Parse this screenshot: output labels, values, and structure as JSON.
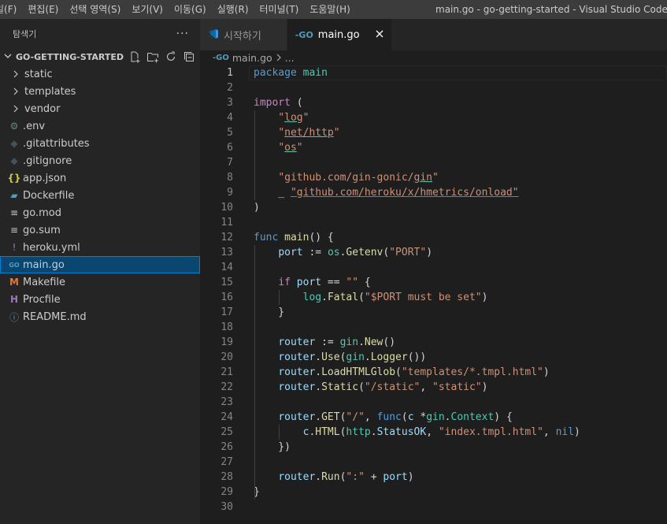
{
  "menu": [
    "일(F)",
    "편집(E)",
    "선택 영역(S)",
    "보기(V)",
    "이동(G)",
    "실행(R)",
    "터미널(T)",
    "도움말(H)"
  ],
  "window_title": "main.go - go-getting-started - Visual Studio Code",
  "sidebar": {
    "header": "탐색기",
    "more": "···",
    "section": "GO-GETTING-STARTED",
    "items": [
      {
        "label": "static",
        "type": "folder",
        "icon": "chevron-right-icon"
      },
      {
        "label": "templates",
        "type": "folder",
        "icon": "chevron-right-icon"
      },
      {
        "label": "vendor",
        "type": "folder",
        "icon": "chevron-right-icon"
      },
      {
        "label": ".env",
        "type": "file",
        "icon": "gear-icon",
        "glyph": "⚙",
        "color": "#6d8086"
      },
      {
        "label": ".gitattributes",
        "type": "file",
        "icon": "git-icon",
        "glyph": "◆",
        "color": "#41535b"
      },
      {
        "label": ".gitignore",
        "type": "file",
        "icon": "git-icon",
        "glyph": "◆",
        "color": "#41535b"
      },
      {
        "label": "app.json",
        "type": "file",
        "icon": "json-icon",
        "glyph": "{}",
        "color": "#cbcb41"
      },
      {
        "label": "Dockerfile",
        "type": "file",
        "icon": "docker-icon",
        "glyph": "▰",
        "color": "#519aba"
      },
      {
        "label": "go.mod",
        "type": "file",
        "icon": "lines-icon",
        "glyph": "≡",
        "color": "#cccccc"
      },
      {
        "label": "go.sum",
        "type": "file",
        "icon": "lines-icon",
        "glyph": "≡",
        "color": "#cccccc"
      },
      {
        "label": "heroku.yml",
        "type": "file",
        "icon": "yaml-icon",
        "glyph": "!",
        "color": "#a074c4"
      },
      {
        "label": "main.go",
        "type": "file",
        "icon": "go-icon",
        "glyph": "GO",
        "color": "#519aba",
        "selected": true
      },
      {
        "label": "Makefile",
        "type": "file",
        "icon": "makefile-icon",
        "glyph": "M",
        "color": "#e37933"
      },
      {
        "label": "Procfile",
        "type": "file",
        "icon": "procfile-icon",
        "glyph": "H",
        "color": "#a074c4"
      },
      {
        "label": "README.md",
        "type": "file",
        "icon": "info-icon",
        "glyph": "ⓘ",
        "color": "#519aba"
      }
    ]
  },
  "tabs": [
    {
      "label": "시작하기",
      "icon": "vscode-icon",
      "active": false
    },
    {
      "label": "main.go",
      "icon": "go-icon",
      "active": true
    }
  ],
  "breadcrumb": {
    "file": "main.go",
    "rest": "..."
  },
  "editor": {
    "current_line": 1,
    "lines": [
      [
        [
          "package",
          "kw"
        ],
        [
          " "
        ],
        [
          "main",
          "pkg"
        ]
      ],
      [],
      [
        [
          "import",
          "ctl"
        ],
        [
          " ("
        ]
      ],
      [
        [
          "    "
        ],
        [
          "\"",
          "str"
        ],
        [
          "log",
          "str ul-g"
        ],
        [
          "\"",
          "str"
        ]
      ],
      [
        [
          "    "
        ],
        [
          "\"",
          "str"
        ],
        [
          "net/http",
          "str ul-g"
        ],
        [
          "\"",
          "str"
        ]
      ],
      [
        [
          "    "
        ],
        [
          "\"",
          "str"
        ],
        [
          "os",
          "str ul-g"
        ],
        [
          "\"",
          "str"
        ]
      ],
      [],
      [
        [
          "    "
        ],
        [
          "\"github.com/gin-gonic/",
          "str"
        ],
        [
          "gin",
          "str ul-g"
        ],
        [
          "\"",
          "str"
        ]
      ],
      [
        [
          "    _ "
        ],
        [
          "\"github.com/heroku/x/hmetrics/onload\"",
          "str ul-r"
        ]
      ],
      [
        [
          ")"
        ]
      ],
      [],
      [
        [
          "func",
          "kw"
        ],
        [
          " "
        ],
        [
          "main",
          "fn"
        ],
        [
          "() {"
        ]
      ],
      [
        [
          "    "
        ],
        [
          "port",
          "var"
        ],
        [
          " := "
        ],
        [
          "os",
          "pkg"
        ],
        [
          "."
        ],
        [
          "Getenv",
          "fn"
        ],
        [
          "("
        ],
        [
          "\"PORT\"",
          "str"
        ],
        [
          ")"
        ]
      ],
      [],
      [
        [
          "    "
        ],
        [
          "if",
          "ctl"
        ],
        [
          " "
        ],
        [
          "port",
          "var"
        ],
        [
          " == "
        ],
        [
          "\"\"",
          "str"
        ],
        [
          " {"
        ]
      ],
      [
        [
          "        "
        ],
        [
          "log",
          "pkg"
        ],
        [
          "."
        ],
        [
          "Fatal",
          "fn"
        ],
        [
          "("
        ],
        [
          "\"$PORT must be set\"",
          "str"
        ],
        [
          ")"
        ]
      ],
      [
        [
          "    }"
        ]
      ],
      [],
      [
        [
          "    "
        ],
        [
          "router",
          "var"
        ],
        [
          " := "
        ],
        [
          "gin",
          "pkg"
        ],
        [
          "."
        ],
        [
          "New",
          "fn"
        ],
        [
          "()"
        ]
      ],
      [
        [
          "    "
        ],
        [
          "router",
          "var"
        ],
        [
          "."
        ],
        [
          "Use",
          "fn"
        ],
        [
          "("
        ],
        [
          "gin",
          "pkg"
        ],
        [
          "."
        ],
        [
          "Logger",
          "fn"
        ],
        [
          "())"
        ]
      ],
      [
        [
          "    "
        ],
        [
          "router",
          "var"
        ],
        [
          "."
        ],
        [
          "LoadHTMLGlob",
          "fn"
        ],
        [
          "("
        ],
        [
          "\"templates/*.tmpl.html\"",
          "str"
        ],
        [
          ")"
        ]
      ],
      [
        [
          "    "
        ],
        [
          "router",
          "var"
        ],
        [
          "."
        ],
        [
          "Static",
          "fn"
        ],
        [
          "("
        ],
        [
          "\"/static\"",
          "str"
        ],
        [
          ", "
        ],
        [
          "\"static\"",
          "str"
        ],
        [
          ")"
        ]
      ],
      [],
      [
        [
          "    "
        ],
        [
          "router",
          "var"
        ],
        [
          "."
        ],
        [
          "GET",
          "fn"
        ],
        [
          "("
        ],
        [
          "\"/\"",
          "str"
        ],
        [
          ", "
        ],
        [
          "func",
          "kw"
        ],
        [
          "("
        ],
        [
          "c",
          "var"
        ],
        [
          " *"
        ],
        [
          "gin",
          "pkg"
        ],
        [
          "."
        ],
        [
          "Context",
          "pkg"
        ],
        [
          ") {"
        ]
      ],
      [
        [
          "        "
        ],
        [
          "c",
          "var"
        ],
        [
          "."
        ],
        [
          "HTML",
          "fn"
        ],
        [
          "("
        ],
        [
          "http",
          "pkg"
        ],
        [
          "."
        ],
        [
          "StatusOK",
          "var"
        ],
        [
          ", "
        ],
        [
          "\"index.tmpl.html\"",
          "str"
        ],
        [
          ", "
        ],
        [
          "nil",
          "kw"
        ],
        [
          ")"
        ]
      ],
      [
        [
          "    })"
        ]
      ],
      [],
      [
        [
          "    "
        ],
        [
          "router",
          "var"
        ],
        [
          "."
        ],
        [
          "Run",
          "fn"
        ],
        [
          "("
        ],
        [
          "\":\"",
          "str"
        ],
        [
          " + "
        ],
        [
          "port",
          "var"
        ],
        [
          ")"
        ]
      ],
      [
        [
          "}"
        ]
      ],
      []
    ]
  }
}
